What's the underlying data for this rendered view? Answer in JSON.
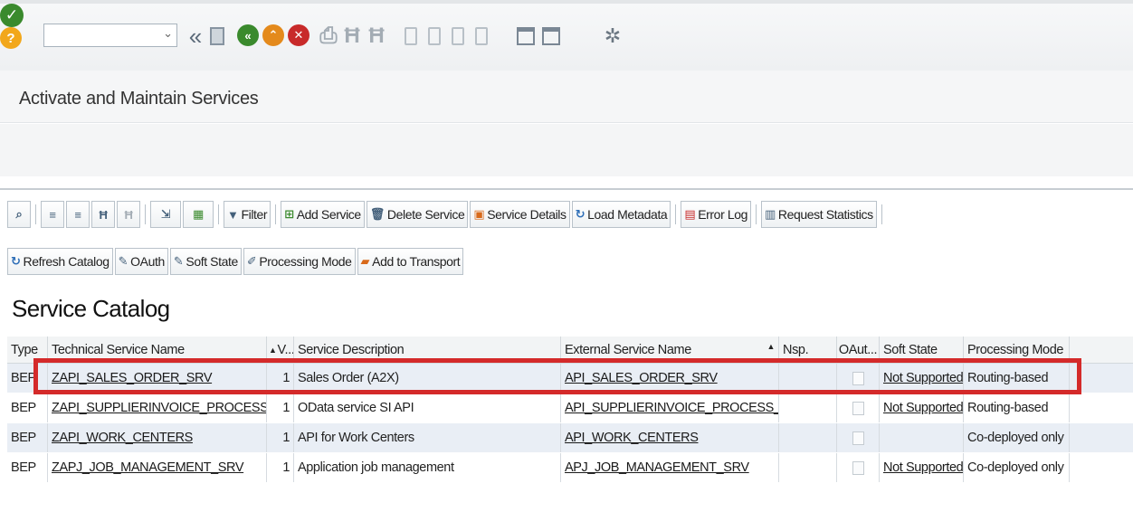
{
  "window": {
    "title": "Activate and Maintain Services"
  },
  "toolbar": {
    "command_field_value": "",
    "icons": [
      "checkmark-icon",
      "double-chevron-left-icon",
      "save-icon",
      "back-icon",
      "exit-icon",
      "cancel-icon",
      "print-icon",
      "find-icon",
      "find-next-icon",
      "first-page-icon",
      "previous-page-icon",
      "next-page-icon",
      "last-page-icon",
      "new-session-icon",
      "shortcut-icon",
      "help-icon",
      "settings-icon"
    ]
  },
  "alv_toolbar": {
    "filter": "Filter",
    "add_service": "Add Service",
    "delete_service": "Delete Service",
    "service_details": "Service Details",
    "load_metadata": "Load Metadata",
    "error_log": "Error Log",
    "request_statistics": "Request Statistics",
    "refresh_catalog": "Refresh Catalog",
    "oauth": "OAuth",
    "soft_state": "Soft State",
    "processing_mode": "Processing Mode",
    "add_to_transport": "Add to Transport"
  },
  "catalog": {
    "title": "Service Catalog",
    "columns": {
      "type": "Type",
      "technical_name": "Technical Service Name",
      "version": "V...",
      "description": "Service Description",
      "external_name": "External Service Name",
      "namespace": "Nsp.",
      "oauth": "OAut...",
      "soft_state": "Soft State",
      "processing_mode": "Processing Mode"
    },
    "rows": [
      {
        "type": "BEP",
        "technical_name": "ZAPI_SALES_ORDER_SRV",
        "version": "1",
        "description": "Sales Order (A2X)",
        "external_name": "API_SALES_ORDER_SRV",
        "namespace": "",
        "soft_state": "Not Supported",
        "processing_mode": "Routing-based"
      },
      {
        "type": "BEP",
        "technical_name": "ZAPI_SUPPLIERINVOICE_PROCESS_SRV",
        "version": "1",
        "description": "OData service SI API",
        "external_name": "API_SUPPLIERINVOICE_PROCESS_SRV",
        "namespace": "",
        "soft_state": "Not Supported",
        "processing_mode": "Routing-based"
      },
      {
        "type": "BEP",
        "technical_name": "ZAPI_WORK_CENTERS",
        "version": "1",
        "description": "API for Work Centers",
        "external_name": "API_WORK_CENTERS",
        "namespace": "",
        "soft_state": "",
        "processing_mode": "Co-deployed only"
      },
      {
        "type": "BEP",
        "technical_name": "ZAPJ_JOB_MANAGEMENT_SRV",
        "version": "1",
        "description": "Application job management",
        "external_name": "APJ_JOB_MANAGEMENT_SRV",
        "namespace": "",
        "soft_state": "Not Supported",
        "processing_mode": "Co-deployed only"
      }
    ]
  },
  "colors": {
    "highlight": "#d42a2a",
    "row_alt": "#e9eef5",
    "ok_green": "#3a8a2d",
    "exit_orange": "#e48a1c",
    "cancel_red": "#c82a2a",
    "help_yellow": "#f2a71b"
  }
}
